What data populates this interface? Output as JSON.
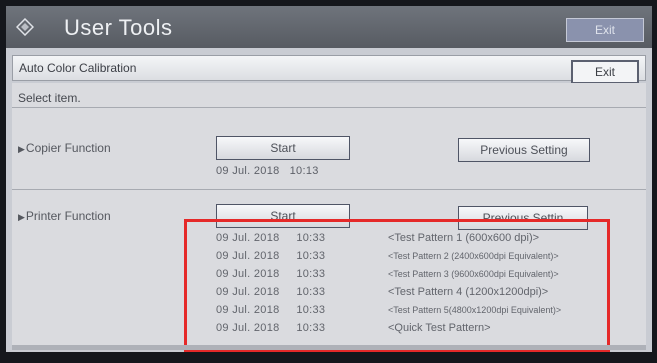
{
  "header": {
    "title": "User Tools",
    "exit_label": "Exit"
  },
  "subheader": {
    "title": "Auto Color Calibration",
    "exit_label": "Exit"
  },
  "prompt": "Select item.",
  "copier": {
    "label": "Copier Function",
    "start_label": "Start",
    "previous_label": "Previous Setting",
    "date": "09 Jul. 2018",
    "time": "10:13"
  },
  "printer": {
    "label": "Printer Function",
    "start_label": "Start",
    "previous_label": "Previous Settin",
    "history": [
      {
        "date": "09 Jul. 2018",
        "time": "10:33",
        "pattern": "<Test Pattern 1 (600x600 dpi)>"
      },
      {
        "date": "09 Jul. 2018",
        "time": "10:33",
        "pattern": "<Test Pattern 2 (2400x600dpi Equivalent)>"
      },
      {
        "date": "09 Jul. 2018",
        "time": "10:33",
        "pattern": "<Test Pattern 3 (9600x600dpi Equivalent)>"
      },
      {
        "date": "09 Jul. 2018",
        "time": "10:33",
        "pattern": "<Test Pattern 4 (1200x1200dpi)>"
      },
      {
        "date": "09 Jul. 2018",
        "time": "10:33",
        "pattern": "<Test Pattern 5(4800x1200dpi Equivalent)>"
      },
      {
        "date": "09 Jul. 2018",
        "time": "10:33",
        "pattern": "<Quick Test Pattern>"
      }
    ]
  },
  "colors": {
    "highlight": "#e52929",
    "titlebar": "#575b62"
  }
}
